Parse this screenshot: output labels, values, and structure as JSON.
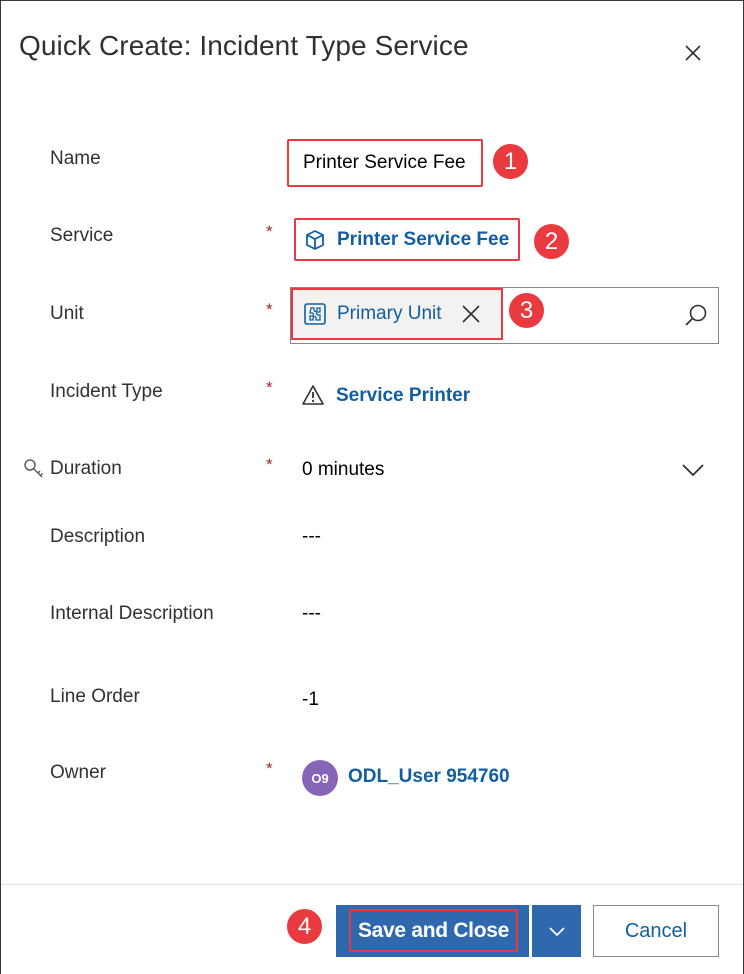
{
  "dialog": {
    "title": "Quick Create: Incident Type Service",
    "close_icon": "close-icon"
  },
  "fields": {
    "name": {
      "label": "Name",
      "value": "Printer Service Fee"
    },
    "service": {
      "label": "Service",
      "value": "Printer Service Fee",
      "required_mark": "*",
      "icon": "cube-icon"
    },
    "unit": {
      "label": "Unit",
      "value": "Primary Unit",
      "required_mark": "*",
      "icon": "unit-icon",
      "search_icon": "search-icon",
      "remove_icon": "close-icon"
    },
    "incident_type": {
      "label": "Incident Type",
      "value": "Service Printer",
      "required_mark": "*",
      "icon": "warning-icon"
    },
    "duration": {
      "label": "Duration",
      "value": "0 minutes",
      "required_mark": "*",
      "key_icon": "key-icon",
      "chevron_icon": "chevron-down-icon"
    },
    "description": {
      "label": "Description",
      "value": "---"
    },
    "internal_description": {
      "label": "Internal Description",
      "value": "---"
    },
    "line_order": {
      "label": "Line Order",
      "value": "-1"
    },
    "owner": {
      "label": "Owner",
      "value": "ODL_User 954760",
      "required_mark": "*",
      "avatar_initials": "O9"
    }
  },
  "footer": {
    "save_label": "Save and Close",
    "cancel_label": "Cancel"
  },
  "callouts": [
    "1",
    "2",
    "3",
    "4"
  ],
  "colors": {
    "accent": "#2f68ad",
    "link": "#115ea3",
    "callout": "#e83a3f",
    "required": "#a4262c",
    "avatar": "#8764b8"
  }
}
